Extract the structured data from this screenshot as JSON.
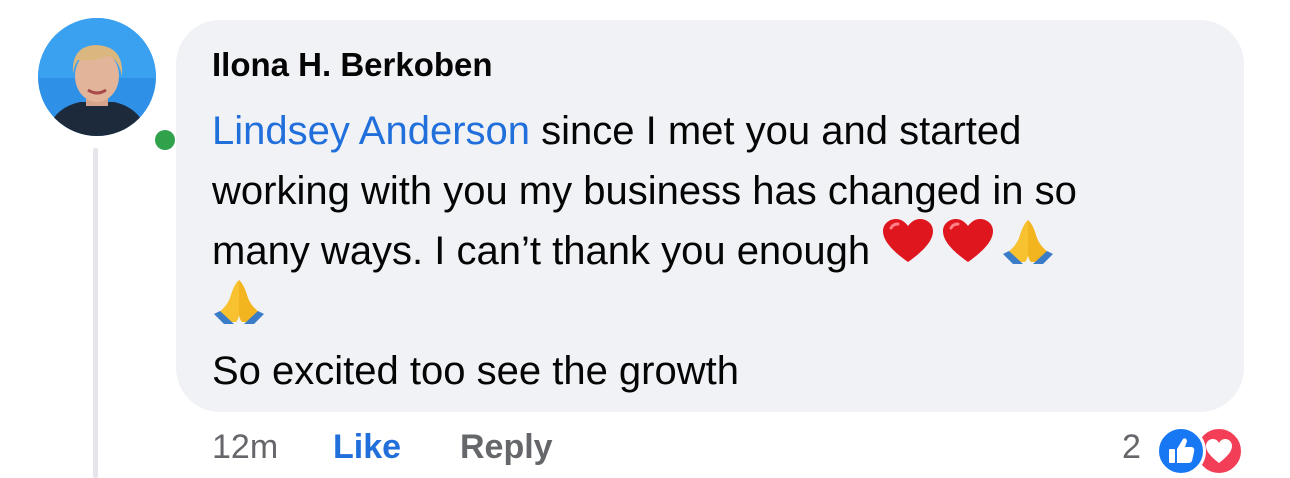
{
  "comment": {
    "author": "Ilona H. Berkoben",
    "mention": "Lindsey Anderson",
    "line1_rest": " since I met you and started",
    "line2": "working with you my business has changed in so",
    "line3": "many ways. I can’t thank you enough ",
    "line5": "So excited too see the growth",
    "emojis": [
      "red-heart",
      "red-heart",
      "folded-hands",
      "folded-hands"
    ],
    "online": true
  },
  "actions": {
    "time": "12m",
    "like": "Like",
    "reply": "Reply"
  },
  "reactions": {
    "count": "2",
    "types": [
      "like",
      "love"
    ]
  },
  "colors": {
    "bubble": "#f0f2f5",
    "mention": "#216fdb",
    "like_action": "#216fdb",
    "online": "#31a24c",
    "like_reaction": "#1877f2",
    "love_reaction": "#f33e58"
  }
}
